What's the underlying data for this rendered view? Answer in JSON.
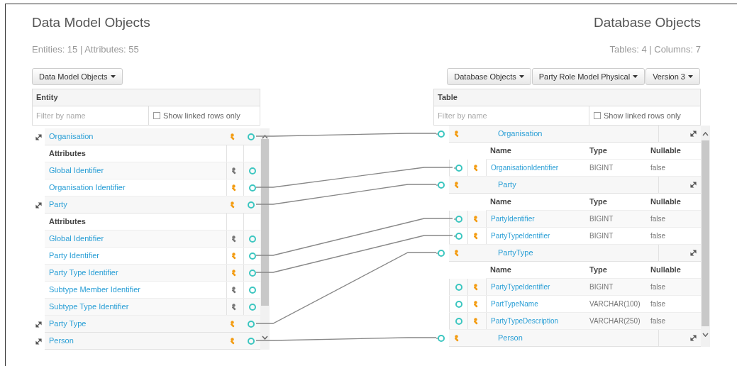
{
  "left": {
    "title": "Data Model Objects",
    "summary": "Entities: 15 | Attributes: 55",
    "buttons": [
      {
        "label": "Data Model Objects"
      }
    ],
    "header": "Entity",
    "filter": {
      "placeholder": "Filter by name"
    },
    "linked_only": {
      "label": "Show linked rows only",
      "checked": false
    },
    "rows": [
      {
        "kind": "entity",
        "name": "Organisation",
        "linked": true
      },
      {
        "kind": "section",
        "name": "Attributes"
      },
      {
        "kind": "attribute",
        "name": "Global Identifier",
        "linked": false
      },
      {
        "kind": "attribute",
        "name": "Organisation Identifier",
        "linked": true
      },
      {
        "kind": "entity",
        "name": "Party",
        "linked": true
      },
      {
        "kind": "section",
        "name": "Attributes"
      },
      {
        "kind": "attribute",
        "name": "Global Identifier",
        "linked": false
      },
      {
        "kind": "attribute",
        "name": "Party Identifier",
        "linked": true
      },
      {
        "kind": "attribute",
        "name": "Party Type Identifier",
        "linked": true
      },
      {
        "kind": "attribute",
        "name": "Subtype Member Identifier",
        "linked": false
      },
      {
        "kind": "attribute",
        "name": "Subtype Type Identifier",
        "linked": false
      },
      {
        "kind": "entity",
        "name": "Party Type",
        "linked": true
      },
      {
        "kind": "entity",
        "name": "Person",
        "linked": true
      }
    ]
  },
  "right": {
    "title": "Database Objects",
    "summary": "Tables: 4 | Columns: 7",
    "buttons": [
      {
        "label": "Database Objects"
      },
      {
        "label": "Party Role Model Physical"
      },
      {
        "label": "Version 3"
      }
    ],
    "header": "Table",
    "filter": {
      "placeholder": "Filter by name"
    },
    "linked_only": {
      "label": "Show linked rows only",
      "checked": false
    },
    "rows": [
      {
        "kind": "table",
        "name": "Organisation",
        "linked": true
      },
      {
        "kind": "header",
        "columns": [
          "Name",
          "Type",
          "Nullable"
        ]
      },
      {
        "kind": "column",
        "name": "OrganisationIdentifier",
        "type": "BIGINT",
        "nullable": "false",
        "linked": true
      },
      {
        "kind": "table",
        "name": "Party",
        "linked": true
      },
      {
        "kind": "header",
        "columns": [
          "Name",
          "Type",
          "Nullable"
        ]
      },
      {
        "kind": "column",
        "name": "PartyIdentifier",
        "type": "BIGINT",
        "nullable": "false",
        "linked": true
      },
      {
        "kind": "column",
        "name": "PartyTypeIdentifier",
        "type": "BIGINT",
        "nullable": "false",
        "linked": true
      },
      {
        "kind": "table",
        "name": "PartyType",
        "linked": true
      },
      {
        "kind": "header",
        "columns": [
          "Name",
          "Type",
          "Nullable"
        ]
      },
      {
        "kind": "column",
        "name": "PartyTypeIdentifier",
        "type": "BIGINT",
        "nullable": "false",
        "linked": false
      },
      {
        "kind": "column",
        "name": "PartTypeName",
        "type": "VARCHAR(100)",
        "nullable": "false",
        "linked": false
      },
      {
        "kind": "column",
        "name": "PartyTypeDescription",
        "type": "VARCHAR(250)",
        "nullable": "false",
        "linked": false
      },
      {
        "kind": "table",
        "name": "Person",
        "linked": true
      }
    ]
  }
}
